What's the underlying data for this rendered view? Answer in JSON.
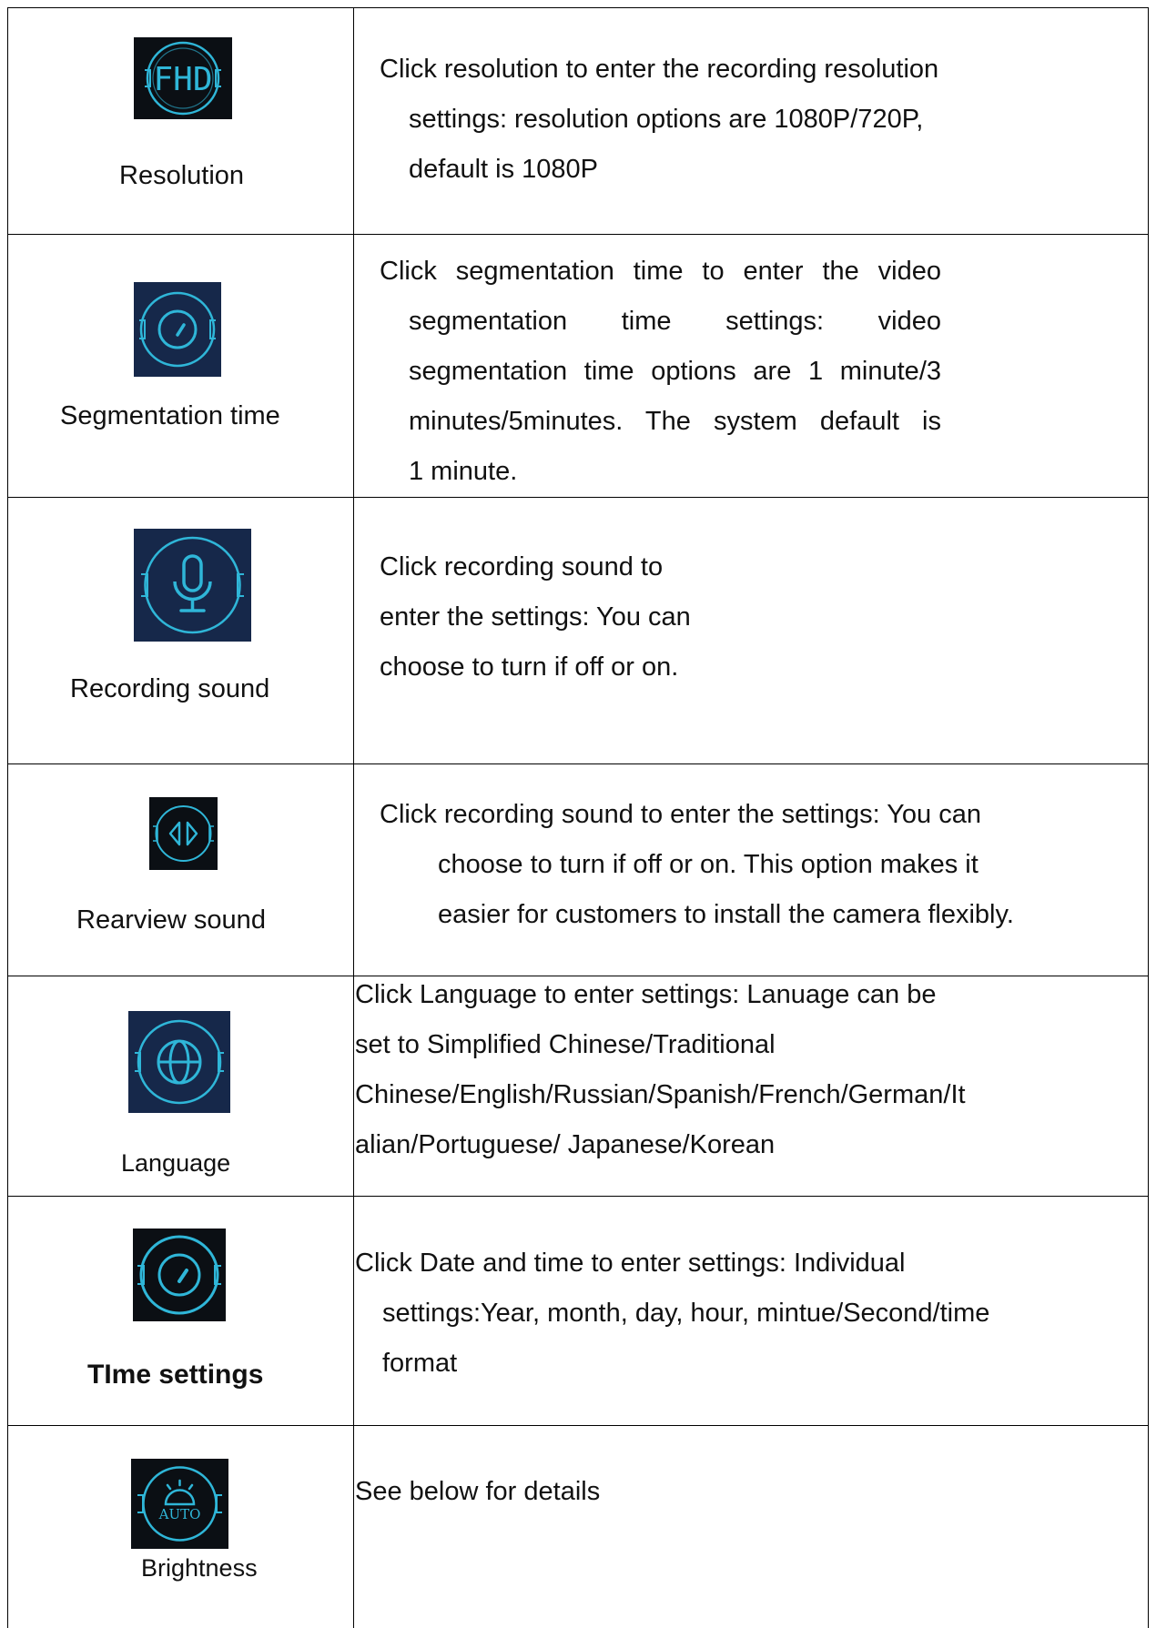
{
  "rows": [
    {
      "icon": "fhd-resolution-icon",
      "label": "Resolution",
      "lines": [
        "Click resolution to enter the recording resolution",
        "settings: resolution options are 1080P/720P,",
        "default is 1080P"
      ]
    },
    {
      "icon": "segmentation-clock-icon",
      "label": "Segmentation time",
      "lines": [
        "Click segmentation time to enter the video",
        "segmentation time settings: video",
        "segmentation time options are 1 minute/3",
        "minutes/5minutes. The system default is",
        "1 minute."
      ]
    },
    {
      "icon": "microphone-icon",
      "label": "Recording sound",
      "lines": [
        "Click recording sound to",
        "enter the settings: You can",
        "choose to turn if off or on."
      ]
    },
    {
      "icon": "rearview-mirror-icon",
      "label": "Rearview sound",
      "lines": [
        "Click recording sound to enter the settings: You can",
        "choose to turn if off or on. This option makes it",
        "easier for customers to install the camera flexibly."
      ]
    },
    {
      "icon": "globe-language-icon",
      "label": "Language",
      "lines": [
        "Click Language to enter settings: Lanuage can be",
        "set to Simplified Chinese/Traditional",
        "Chinese/English/Russian/Spanish/French/German/It",
        "alian/Portuguese/ Japanese/Korean"
      ]
    },
    {
      "icon": "time-clock-icon",
      "label": "TIme settings",
      "lines": [
        "Click Date and time to enter settings: Individual",
        "settings:Year, month, day, hour, mintue/Second/time",
        "format"
      ]
    },
    {
      "icon": "brightness-auto-icon",
      "label": "Brightness",
      "lines": [
        "See below for details"
      ]
    }
  ],
  "colors": {
    "icon_dark": "#0b0f14",
    "icon_navy": "#16284a",
    "icon_cyan": "#2fb6d8"
  }
}
